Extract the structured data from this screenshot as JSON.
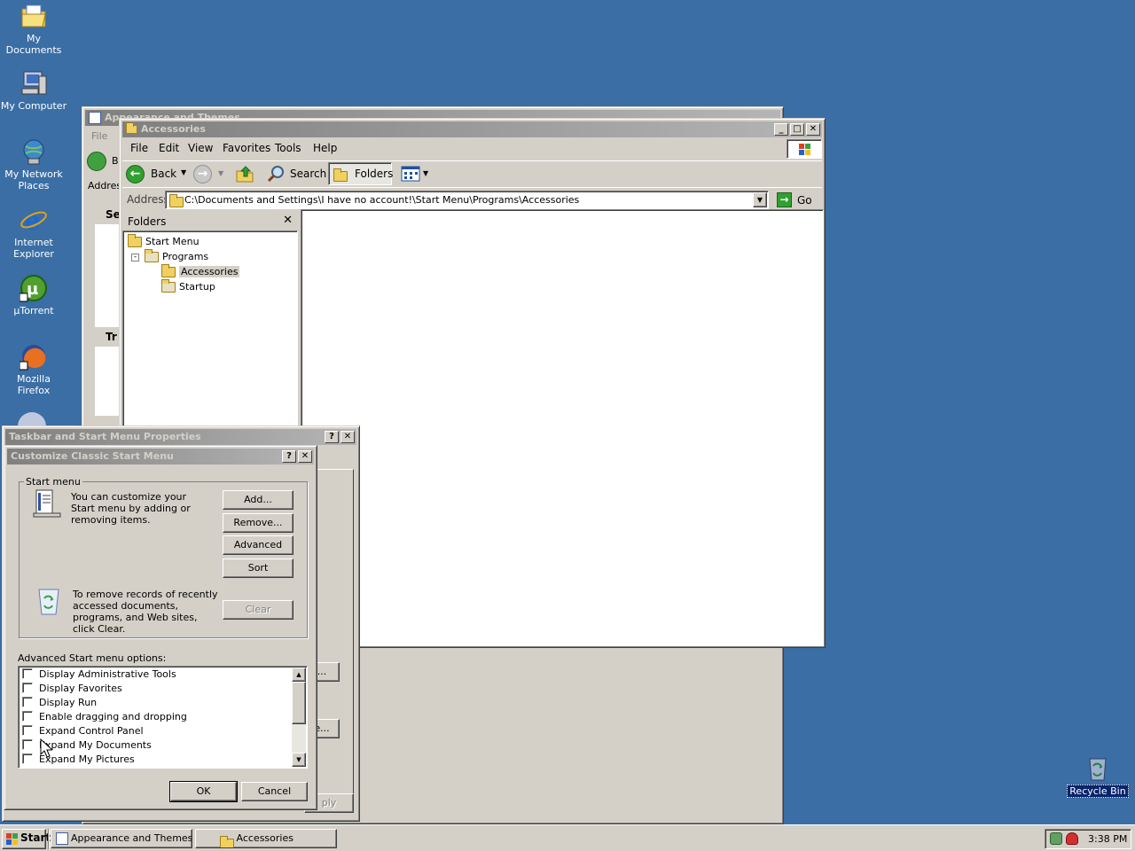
{
  "desktop": {
    "icons": [
      {
        "label": "My Documents",
        "icon": "my-documents-icon"
      },
      {
        "label": "My Computer",
        "icon": "my-computer-icon"
      },
      {
        "label": "My Network Places",
        "icon": "network-places-icon"
      },
      {
        "label": "Internet Explorer",
        "icon": "internet-explorer-icon"
      },
      {
        "label": "µTorrent",
        "icon": "utorrent-icon"
      },
      {
        "label": "Mozilla Firefox",
        "icon": "firefox-icon"
      }
    ],
    "recycle_bin": "Recycle Bin",
    "background_color": "#3a6ea5"
  },
  "appearance_window": {
    "title": "Appearance and Themes",
    "menu_file": "File",
    "back_partial": "B",
    "address_partial": "Addres",
    "section1_partial": "Se",
    "section2_partial": "Tr"
  },
  "explorer": {
    "title": "Accessories",
    "menu": [
      "File",
      "Edit",
      "View",
      "Favorites",
      "Tools",
      "Help"
    ],
    "toolbar": {
      "back": "Back",
      "search": "Search",
      "folders": "Folders"
    },
    "address_label": "Address",
    "address_value": "C:\\Documents and Settings\\I have no account!\\Start Menu\\Programs\\Accessories",
    "go": "Go",
    "folders_pane_title": "Folders",
    "tree": [
      {
        "label": "Start Menu",
        "level": 0
      },
      {
        "label": "Programs",
        "level": 1
      },
      {
        "label": "Accessories",
        "level": 2,
        "selected": true
      },
      {
        "label": "Startup",
        "level": 2
      }
    ]
  },
  "taskbar_props": {
    "title": "Taskbar and Start Menu Properties",
    "partial_btn1": "...",
    "partial_btn2": "e...",
    "partial_apply": "ply"
  },
  "customize": {
    "title": "Customize Classic Start Menu",
    "group_label": "Start menu",
    "description": "You can customize your Start menu by adding or removing items.",
    "buttons": {
      "add": "Add...",
      "remove": "Remove...",
      "advanced": "Advanced",
      "sort": "Sort",
      "clear": "Clear"
    },
    "clear_text": "To remove records of recently accessed documents, programs, and Web sites, click Clear.",
    "options_label": "Advanced Start menu options:",
    "options": [
      "Display Administrative Tools",
      "Display Favorites",
      "Display Run",
      "Enable dragging and dropping",
      "Expand Control Panel",
      "Expand My Documents",
      "Expand My Pictures"
    ],
    "ok": "OK",
    "cancel": "Cancel"
  },
  "taskbar": {
    "start": "Start",
    "tasks": [
      "Appearance and Themes",
      "Accessories"
    ],
    "clock": "3:38 PM"
  }
}
